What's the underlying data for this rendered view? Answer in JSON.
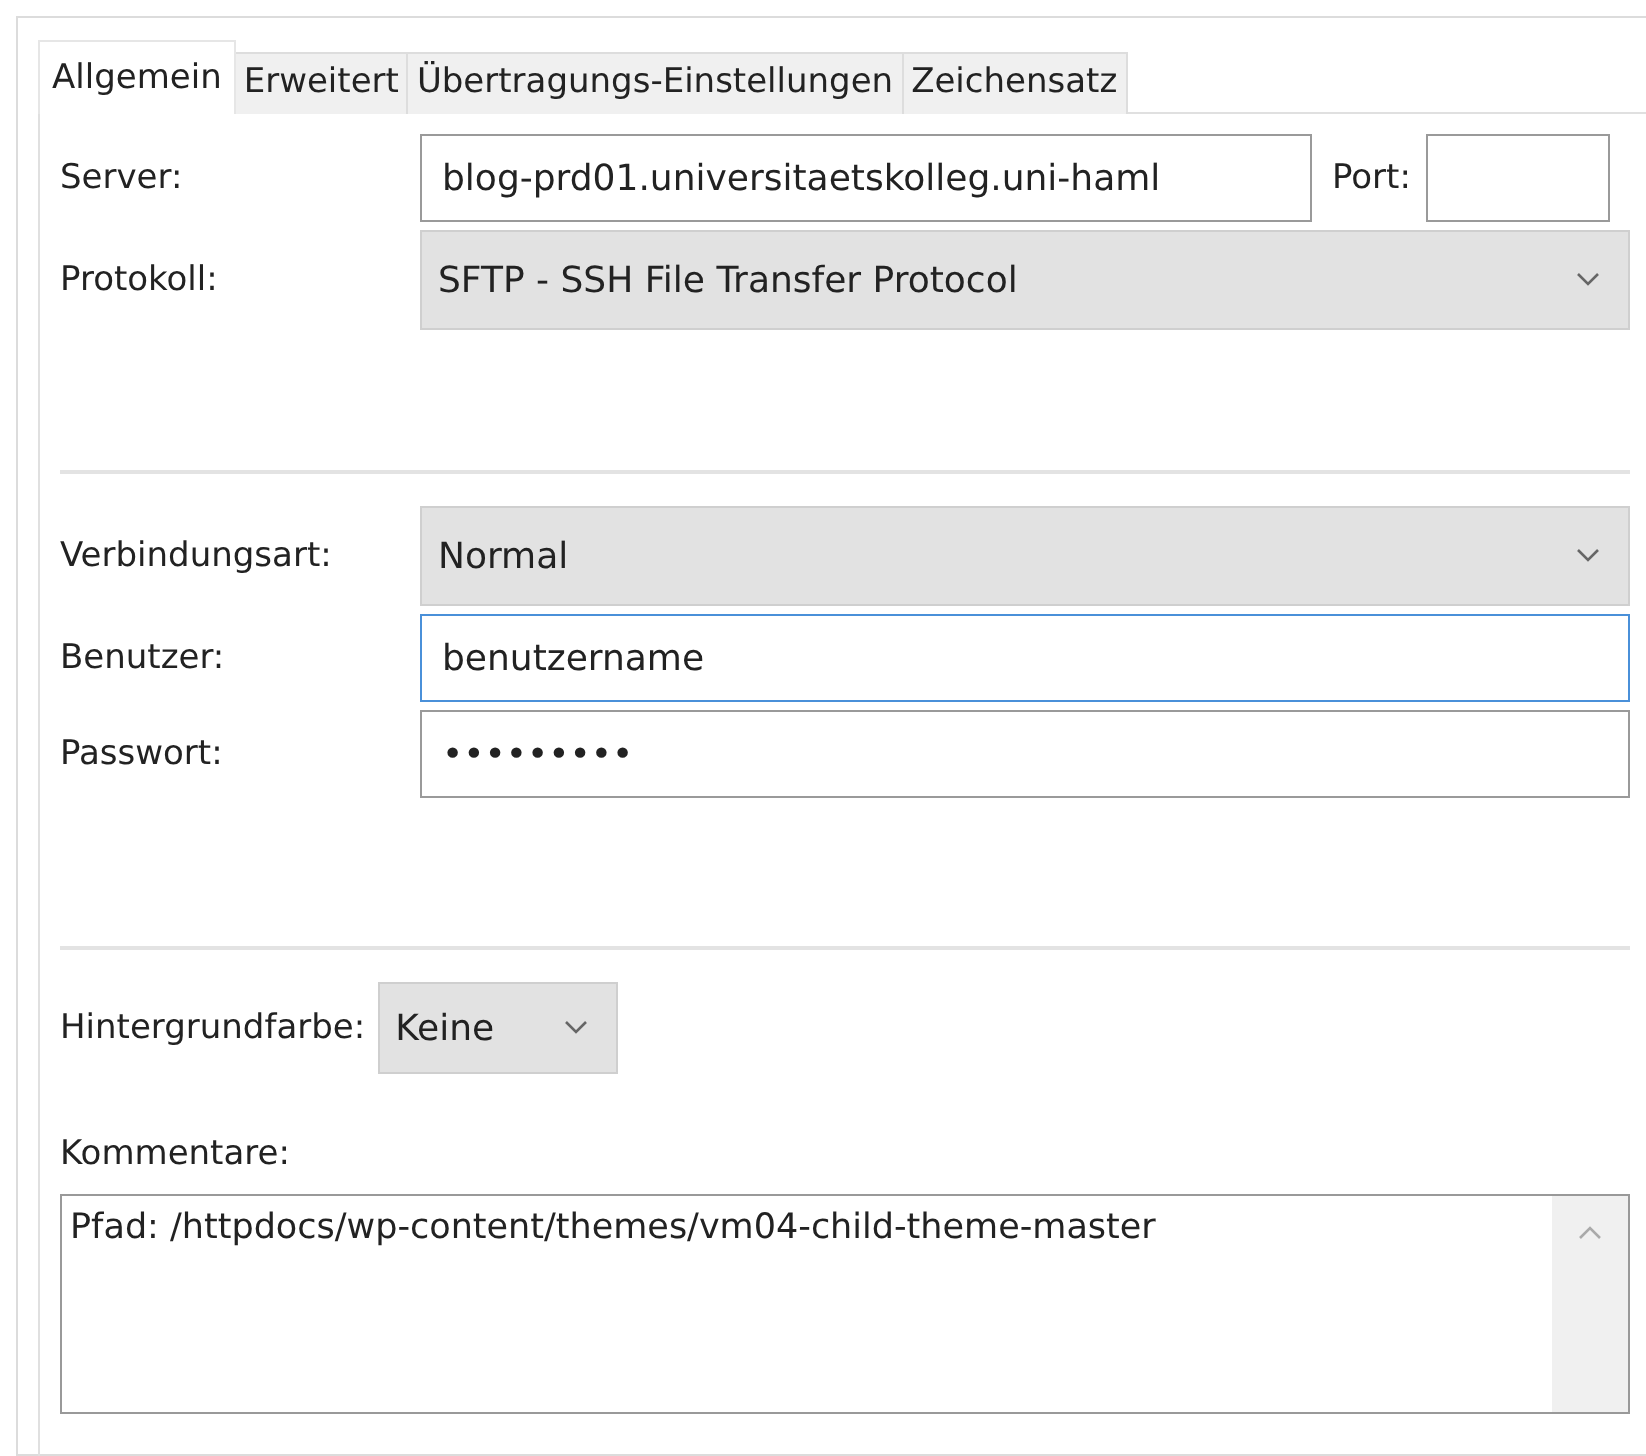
{
  "tabs": [
    {
      "label": "Allgemein",
      "selected": true
    },
    {
      "label": "Erweitert",
      "selected": false
    },
    {
      "label": "Übertragungs-Einstellungen",
      "selected": false
    },
    {
      "label": "Zeichensatz",
      "selected": false
    }
  ],
  "server": {
    "label": "Server:",
    "value": "blog-prd01.universitaetskolleg.uni-haml",
    "port_label": "Port:"
  },
  "protocol": {
    "label": "Protokoll:",
    "value": "SFTP - SSH File Transfer Protocol"
  },
  "connection_type": {
    "label": "Verbindungsart:",
    "value": "Normal"
  },
  "user": {
    "label": "Benutzer:",
    "value": "benutzername",
    "focused": true
  },
  "password": {
    "label": "Passwort:",
    "value": "•••••••••",
    "focused": false
  },
  "background_color": {
    "label": "Hintergrundfarbe:",
    "value": "Keine"
  },
  "comments": {
    "label": "Kommentare:",
    "value": "Pfad: /httpdocs/wp-content/themes/vm04-child-theme-master"
  }
}
